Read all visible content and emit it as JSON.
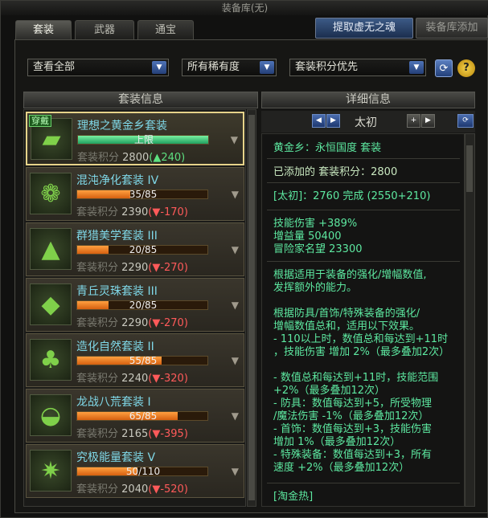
{
  "window": {
    "title": "装备库(无)"
  },
  "tabs": [
    {
      "label": "套装"
    },
    {
      "label": "武器"
    },
    {
      "label": "通宝"
    }
  ],
  "top_buttons": {
    "extract": "提取虚无之魂",
    "add": "装备库添加"
  },
  "filters": {
    "view": "查看全部",
    "rarity": "所有稀有度",
    "sort": "套装积分优先"
  },
  "left_panel": {
    "header": "套装信息",
    "score_label": "套装积分",
    "items": [
      {
        "name": "理想之黄金乡套装",
        "progress_text": "上限",
        "progress": 1.0,
        "score": "2800",
        "delta": "(▲240)",
        "delta_dir": "up",
        "badge": "穿戴",
        "icon": "gold-bars-icon"
      },
      {
        "name": "混沌净化套装 IV",
        "progress_text": "35/85",
        "progress": 0.412,
        "score": "2390",
        "delta": "(▼-170)",
        "delta_dir": "down",
        "icon": "rose-icon"
      },
      {
        "name": "群猎美学套装 III",
        "progress_text": "20/85",
        "progress": 0.235,
        "score": "2290",
        "delta": "(▼-270)",
        "delta_dir": "down",
        "icon": "wolf-icon"
      },
      {
        "name": "青丘灵珠套装 III",
        "progress_text": "20/85",
        "progress": 0.235,
        "score": "2290",
        "delta": "(▼-270)",
        "delta_dir": "down",
        "icon": "fox-icon"
      },
      {
        "name": "造化自然套装 II",
        "progress_text": "55/85",
        "progress": 0.647,
        "score": "2240",
        "delta": "(▼-320)",
        "delta_dir": "down",
        "icon": "tree-icon"
      },
      {
        "name": "龙战八荒套装 I",
        "progress_text": "65/85",
        "progress": 0.765,
        "score": "2165",
        "delta": "(▼-395)",
        "delta_dir": "down",
        "icon": "sunrise-icon"
      },
      {
        "name": "究极能量套装 V",
        "progress_text": "50/110",
        "progress": 0.455,
        "score": "2040",
        "delta": "(▼-520)",
        "delta_dir": "down",
        "icon": "burst-icon"
      }
    ]
  },
  "right_panel": {
    "header": "详细信息",
    "nav_label": "太初",
    "lines": [
      "黄金乡：永恒国度  套装",
      "已添加的 套装积分：2800",
      "[太初]：2760 完成 (2550+210)",
      "技能伤害 +389%",
      "增益量 50400",
      "冒险家名望 23300",
      "根据适用于装备的强化/增幅数值,",
      "发挥额外的能力。",
      "根据防具/首饰/特殊装备的强化/",
      "增幅数值总和，适用以下效果。",
      "- 110以上时，数值总和每达到+11时",
      "，技能伤害 增加 2%（最多叠加2次）",
      "- 数值总和每达到+11时，技能范围",
      "+2%（最多叠加12次）",
      "- 防具：数值每达到+5，所受物理",
      "/魔法伤害 -1%（最多叠加12次）",
      "- 首饰：数值每达到+3，技能伤害",
      "增加 1%（最多叠加12次）",
      "- 特殊装备：数值每达到+3，所有",
      "速度 +2%（最多叠加12次）",
      "[淘金热]"
    ]
  }
}
